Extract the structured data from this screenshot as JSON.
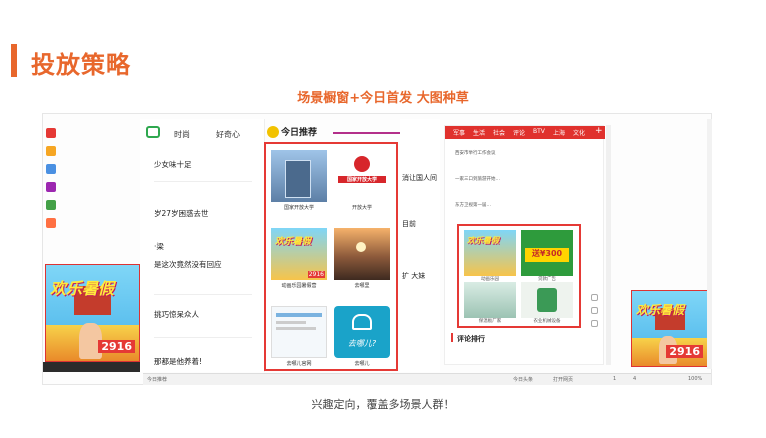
{
  "slide": {
    "title": "投放策略",
    "subtitle": "场景橱窗+今日首发 大图种草",
    "caption": "兴趣定向，覆盖多场景人群！"
  },
  "colors": {
    "accent": "#e8672c",
    "highlight": "#e53935",
    "news_red": "#e0312d"
  },
  "news_column": {
    "tabs": [
      "时尚",
      "好奇心"
    ],
    "rows": [
      "少女味十足",
      "岁27岁困惑去世",
      "·梁",
      "是这次竟然没有回应",
      "挑巧惊呆众人",
      "那都是他养着!"
    ]
  },
  "recommend": {
    "header": "今日推荐",
    "tiles": [
      {
        "label": "国家开放大学",
        "icon": "building-photo"
      },
      {
        "label": "开放大学",
        "icon": "university-logo",
        "logo_text": "国家开放大学"
      },
      {
        "label": "动画乐园暑假营",
        "icon": "theme-park-ad"
      },
      {
        "label": "去哪里",
        "icon": "sunset-photo"
      },
      {
        "label": "去哪儿官网",
        "icon": "webpage-thumb"
      },
      {
        "label": "去哪儿",
        "icon": "camel-logo",
        "logo_text": "去哪儿?"
      }
    ]
  },
  "middle": {
    "texts": [
      "消让国人间",
      "目前",
      "扩 大妹"
    ]
  },
  "right_panel": {
    "nav": [
      "军事",
      "生活",
      "社会",
      "评论",
      "BTV",
      "上海",
      "文化"
    ],
    "news": [
      "西安市举行工作会议",
      "一家三口到旅游开始…",
      "东方卫视第一届…"
    ],
    "box_tiles": [
      {
        "label": "动画乐园",
        "icon": "theme-park-ad"
      },
      {
        "label": "贷款广告",
        "icon": "loan-ad",
        "ad_text": "送¥300"
      },
      {
        "label": "保温板厂家",
        "icon": "board-photo"
      },
      {
        "label": "农业机械设备",
        "icon": "machine-photo"
      }
    ],
    "rank_title": "评论排行"
  },
  "ads": {
    "headline": "欢乐暑假",
    "price": "2916"
  },
  "bottom_bar": {
    "left": "今日推荐",
    "items": [
      "今日头条",
      "打开网页",
      "1",
      "4",
      "100%"
    ]
  }
}
